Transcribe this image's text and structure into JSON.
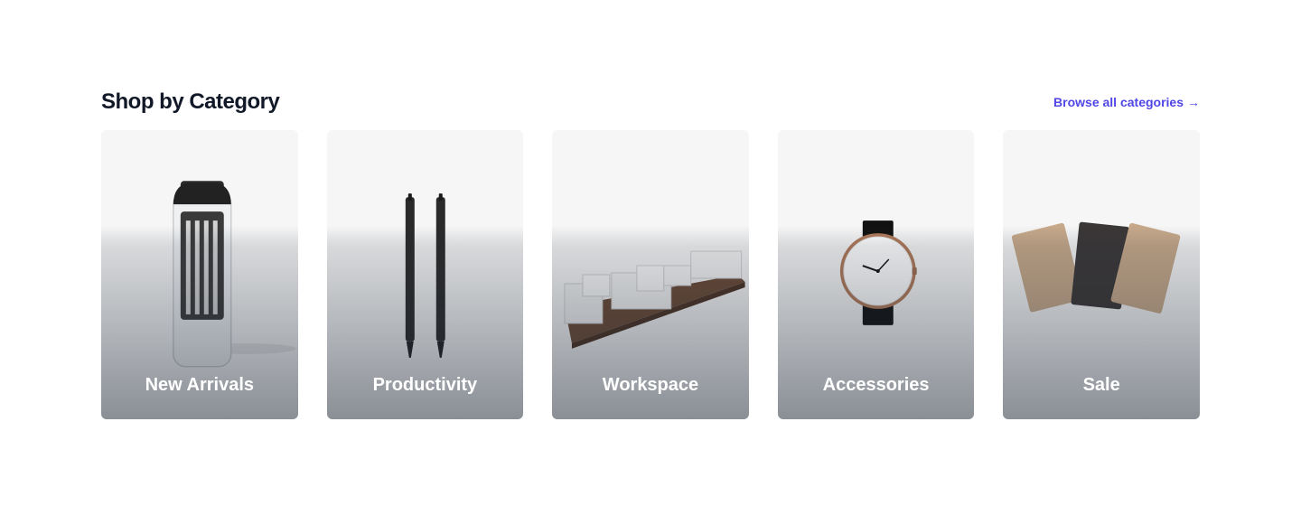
{
  "section": {
    "title": "Shop by Category",
    "browse_label": "Browse all categories",
    "browse_arrow": "→"
  },
  "categories": [
    {
      "name": "New Arrivals",
      "image": "glass-carafe-icon"
    },
    {
      "name": "Productivity",
      "image": "pens-icon"
    },
    {
      "name": "Workspace",
      "image": "desk-organizer-icon"
    },
    {
      "name": "Accessories",
      "image": "wristwatch-icon"
    },
    {
      "name": "Sale",
      "image": "notebooks-icon"
    }
  ],
  "colors": {
    "title": "#111827",
    "link": "#4f46e5",
    "card_bg": "#f6f6f6"
  }
}
